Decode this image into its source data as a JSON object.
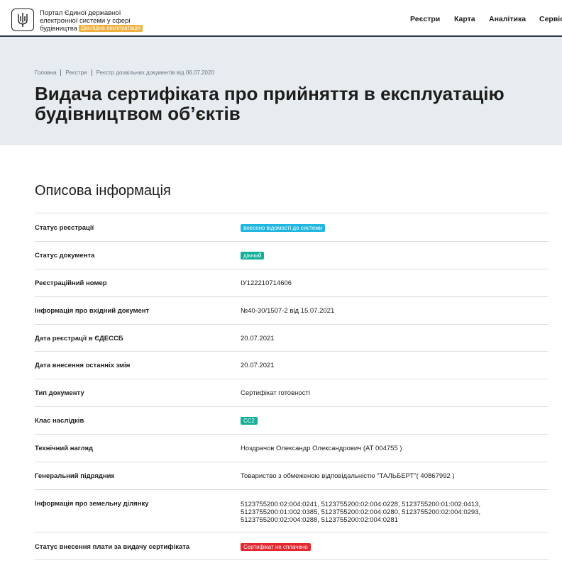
{
  "header": {
    "portal_title_lines": [
      "Портал Єдиної державної",
      "електронної системи у сфері",
      "будівництва"
    ],
    "trial_badge": "Дослідна експлуатація",
    "nav": [
      "Реєстри",
      "Карта",
      "Аналітика",
      "Сервіс"
    ]
  },
  "breadcrumb": [
    "Головна",
    "Реєстри",
    "Реєстр дозвільних документів від 06.07.2020"
  ],
  "page_title_lines": [
    "Видача сертифіката про прийняття в експлуатацію",
    "будівництвом об’єктів"
  ],
  "section_title": "Описова інформація",
  "rows": [
    {
      "label": "Статус реєстрації",
      "value": "внесено відомості до системи",
      "pill_color": "#1fb6e0"
    },
    {
      "label": "Статус документа",
      "value": "діючий",
      "pill_color": "#12b09a"
    },
    {
      "label": "Реєстраційний номер",
      "value": "ІУ122210714606"
    },
    {
      "label": "Інформація про вхідний документ",
      "value": "№40-30/1507-2 від 15.07.2021"
    },
    {
      "label": "Дата реєстрації в ЄДЕССБ",
      "value": "20.07.2021"
    },
    {
      "label": "Дата внесення останніх змін",
      "value": "20.07.2021"
    },
    {
      "label": "Тип документу",
      "value": "Сертифікат готовності"
    },
    {
      "label": "Клас наслідків",
      "value": "СС2",
      "pill_color": "#12b09a"
    },
    {
      "label": "Технічний нагляд",
      "value": "Ноздрачов Олександр Олександрович (АТ 004755 )"
    },
    {
      "label": "Генеральний підрядник",
      "value": "Товариство з обмеженою відповідальністю \"ТАЛЬБЕРТ\"( 40867992 )"
    },
    {
      "label": "Інформація про земельну ділянку",
      "value_lines": [
        "5123755200:02:004:0241, 5123755200:02:004:0228, 5123755200:01:002:0413,",
        "5123755200:01:002:0385, 5123755200:02:004:0280, 5123755200:02:004:0293,",
        "5123755200:02:004:0288, 5123755200:02:004:0281"
      ]
    },
    {
      "label": "Статус внесення плати за видачу сертифіката",
      "value": "Сертифікат не сплачено",
      "pill_color": "#e4262e"
    }
  ]
}
